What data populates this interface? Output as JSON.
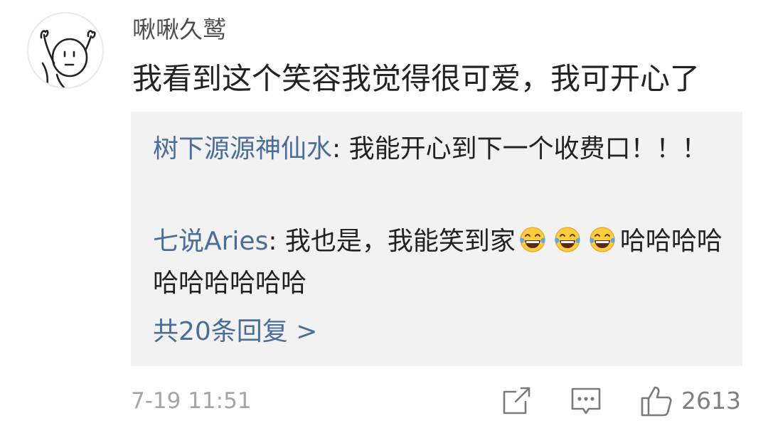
{
  "comment": {
    "username": "啾啾久鹫",
    "text": "我看到这个笑容我觉得很可爱，我可开心了",
    "avatar_icon": "stick-figure-cheering-icon",
    "replies": [
      {
        "name": "树下源源神仙水",
        "text": ": 我能开心到下一个收费口！！！"
      },
      {
        "name": "七说Aries",
        "text_before_emoji": ": 我也是，我能笑到家",
        "emoji_icon": "tears-of-joy-emoji-icon",
        "emoji_count": 3,
        "text_after_emoji": "哈哈哈哈哈哈哈哈哈哈"
      }
    ],
    "total_replies_label": "共20条回复 >",
    "timestamp": "7-19 11:51",
    "actions": {
      "share_icon": "share-icon",
      "reply_icon": "comment-icon",
      "like_icon": "thumbs-up-icon",
      "like_count": "2613"
    },
    "colors": {
      "link_blue": "#4a6d9a",
      "reply_background": "#f2f2f2",
      "muted_gray": "#a5a5a5"
    }
  }
}
